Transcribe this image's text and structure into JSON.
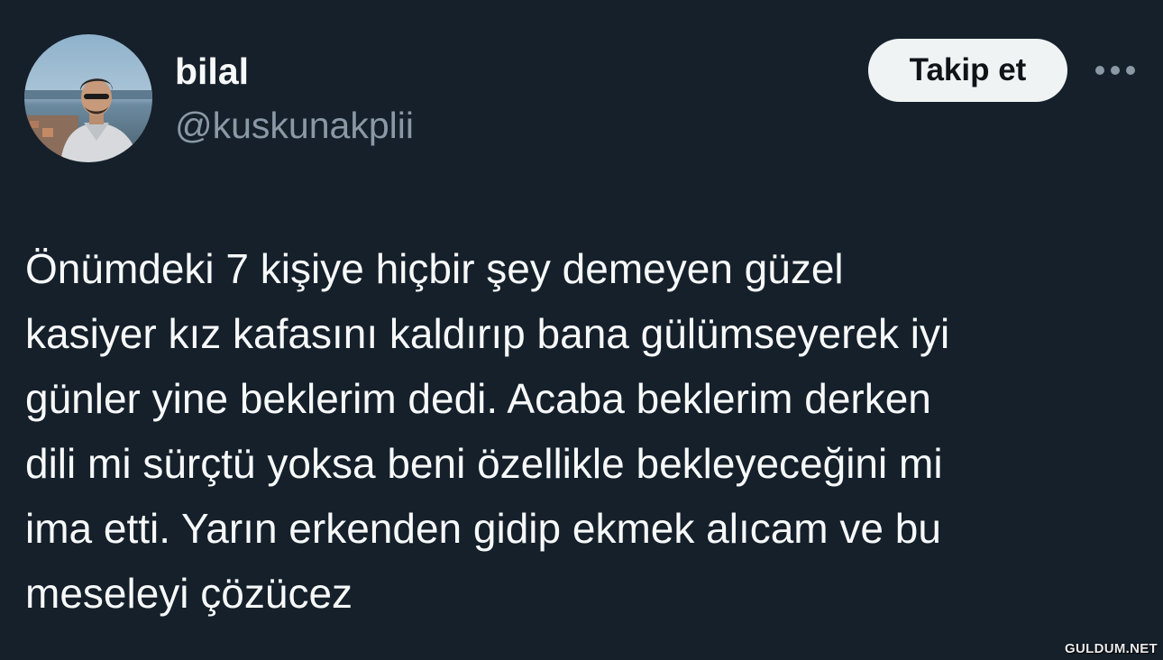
{
  "user": {
    "display_name": "bilal",
    "handle": "@kuskunakplii",
    "avatar_icon": "profile-photo"
  },
  "actions": {
    "follow_label": "Takip et",
    "more_icon": "ellipsis-icon"
  },
  "tweet": {
    "text": "Önümdeki 7 kişiye hiçbir şey demeyen güzel\nkasiyer kız kafasını kaldırıp bana gülümseyerek iyi\ngünler yine beklerim dedi. Acaba beklerim derken\ndili mi sürçtü yoksa beni özellikle bekleyeceğini mi\nima etti. Yarın erkenden gidip ekmek alıcam ve bu\nmeseleyi çözücez"
  },
  "watermark": "GULDUM.NET",
  "colors": {
    "background": "#15202b",
    "text_primary": "#f7f9f9",
    "text_secondary": "#8b98a5",
    "button_bg": "#eff3f4",
    "button_text": "#0f1419"
  }
}
